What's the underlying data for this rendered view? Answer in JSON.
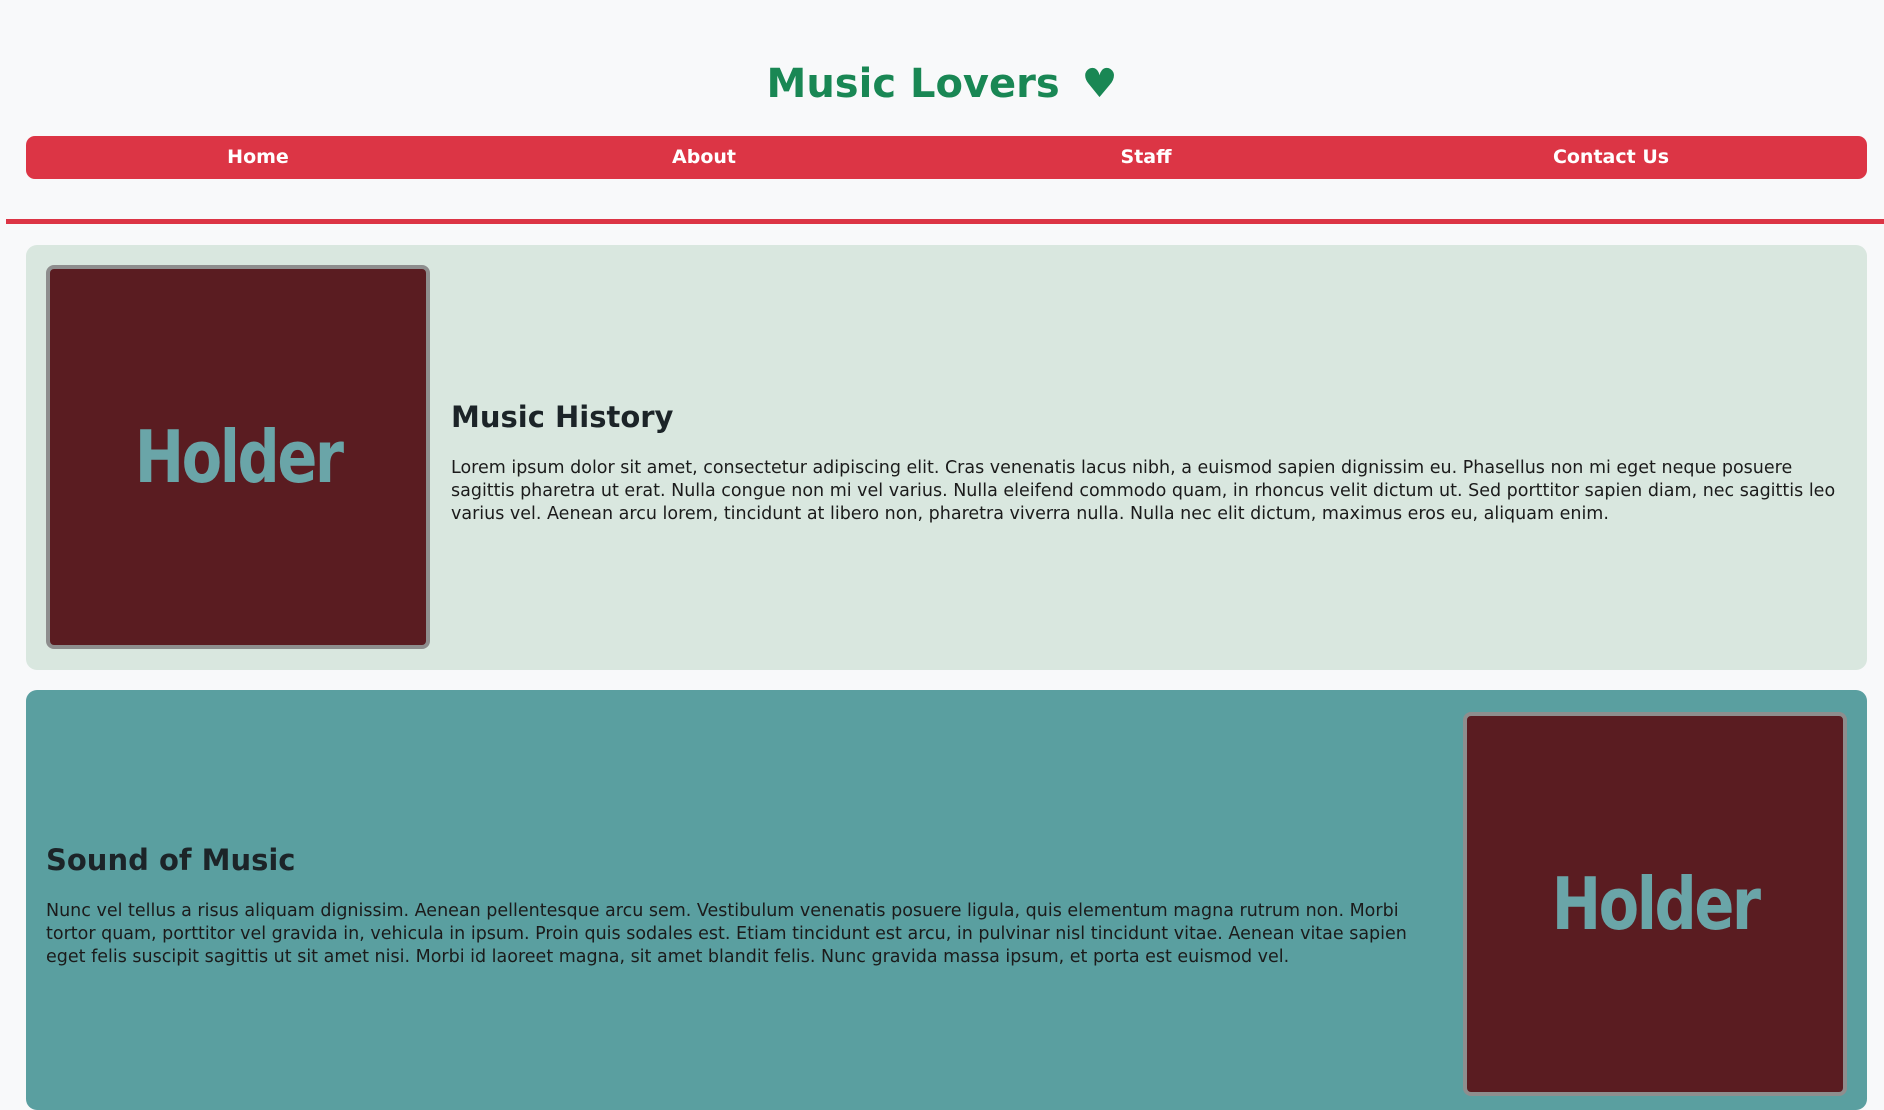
{
  "header": {
    "title": "Music Lovers",
    "heart_icon": "♥"
  },
  "nav": {
    "items": [
      {
        "label": "Home"
      },
      {
        "label": "About"
      },
      {
        "label": "Staff"
      },
      {
        "label": "Contact Us"
      }
    ]
  },
  "colors": {
    "brand_green": "#198754",
    "nav_red": "#dc3545",
    "card1_bg": "#d9e7df",
    "card2_bg": "#5a9fa0",
    "placeholder_bg": "#5a1c21",
    "placeholder_text": "#6aa5a8"
  },
  "sections": [
    {
      "heading": "Music History",
      "image_label": "Holder",
      "body": "Lorem ipsum dolor sit amet, consectetur adipiscing elit. Cras venenatis lacus nibh, a euismod sapien dignissim eu. Phasellus non mi eget neque posuere sagittis pharetra ut erat. Nulla congue non mi vel varius. Nulla eleifend commodo quam, in rhoncus velit dictum ut. Sed porttitor sapien diam, nec sagittis leo varius vel. Aenean arcu lorem, tincidunt at libero non, pharetra viverra nulla. Nulla nec elit dictum, maximus eros eu, aliquam enim."
    },
    {
      "heading": "Sound of Music",
      "image_label": "Holder",
      "body": "Nunc vel tellus a risus aliquam dignissim. Aenean pellentesque arcu sem. Vestibulum venenatis posuere ligula, quis elementum magna rutrum non. Morbi tortor quam, porttitor vel gravida in, vehicula in ipsum. Proin quis sodales est. Etiam tincidunt est arcu, in pulvinar nisl tincidunt vitae. Aenean vitae sapien eget felis suscipit sagittis ut sit amet nisi. Morbi id laoreet magna, sit amet blandit felis. Nunc gravida massa ipsum, et porta est euismod vel."
    }
  ]
}
